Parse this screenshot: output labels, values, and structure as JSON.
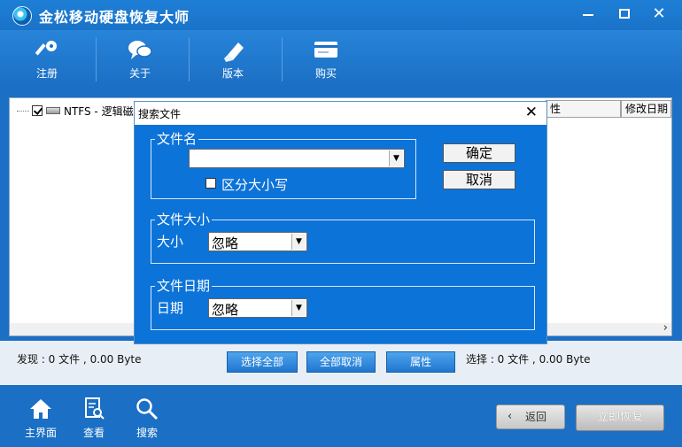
{
  "window": {
    "title": "金松移动硬盘恢复大师",
    "minimize_glyph": "",
    "close_glyph": "✕"
  },
  "toolbar": {
    "items": [
      {
        "label": "注册",
        "icon": "key-icon"
      },
      {
        "label": "关于",
        "icon": "chat-bubble-icon"
      },
      {
        "label": "版本",
        "icon": "tag-icon"
      },
      {
        "label": "购买",
        "icon": "card-icon"
      }
    ]
  },
  "file_panel": {
    "tree_item": "NTFS - 逻辑磁盘",
    "tree_checked": true,
    "columns": [
      "性",
      "修改日期"
    ],
    "scroll_arrow": "›"
  },
  "status": {
    "found": "发现 : 0 文件 , 0.00 Byte",
    "selected": "选择 : 0 文件 , 0.00 Byte",
    "select_all": "选择全部",
    "deselect_all": "全部取消",
    "properties": "属性"
  },
  "bottom_nav": {
    "items": [
      {
        "label": "主界面",
        "icon": "home-icon"
      },
      {
        "label": "查看",
        "icon": "document-search-icon"
      },
      {
        "label": "搜索",
        "icon": "magnifier-icon"
      }
    ],
    "back": "返回",
    "back_glyph": "‹",
    "recover": "立即恢复"
  },
  "search_dialog": {
    "title": "搜索文件",
    "close_glyph": "✕",
    "filename_group": "文件名",
    "filename_value": "",
    "case_sensitive": "区分大小写",
    "case_sensitive_checked": false,
    "ok": "确定",
    "cancel": "取消",
    "size_group": "文件大小",
    "size_label": "大小",
    "size_value": "忽略",
    "date_group": "文件日期",
    "date_label": "日期",
    "date_value": "忽略",
    "drop_glyph": "▼"
  },
  "colors": {
    "primary_blue": "#1b6fc4",
    "dialog_blue": "#0c73d8"
  }
}
